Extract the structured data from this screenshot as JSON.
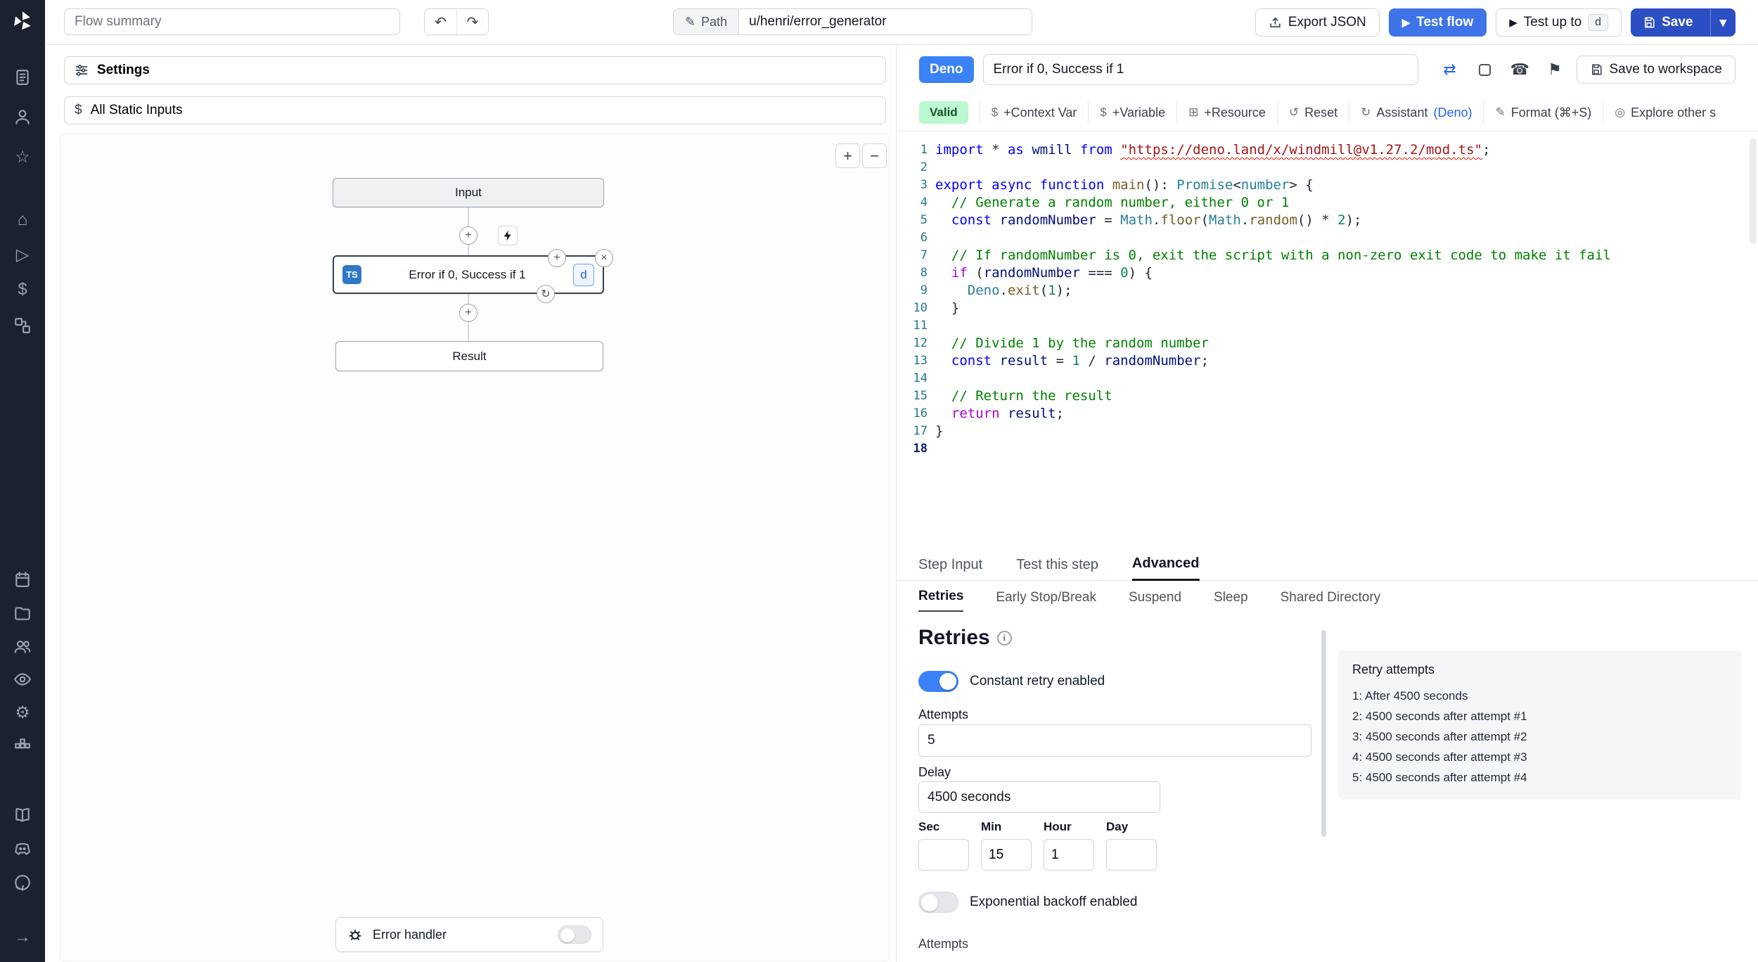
{
  "topbar": {
    "flow_summary_placeholder": "Flow summary",
    "path_label": "Path",
    "path_value": "u/henri/error_generator",
    "export_json_label": "Export JSON",
    "test_flow_label": "Test flow",
    "test_up_to_label": "Test up to",
    "test_up_to_badge": "d",
    "save_label": "Save"
  },
  "flow": {
    "settings_label": "Settings",
    "static_inputs_label": "All Static Inputs",
    "zoom_in_label": "+",
    "zoom_out_label": "−",
    "input_node_label": "Input",
    "step": {
      "lang_badge": "TS",
      "label": "Error if 0, Success if 1",
      "badge": "d"
    },
    "result_node_label": "Result",
    "error_handler_label": "Error handler"
  },
  "right_panel": {
    "header": {
      "lang_badge": "Deno",
      "step_name": "Error if 0, Success if 1",
      "save_to_workspace_label": "Save to workspace"
    },
    "toolbar": {
      "valid_label": "Valid",
      "context_var_label": "+Context Var",
      "variable_label": "+Variable",
      "resource_label": "+Resource",
      "reset_label": "Reset",
      "assistant_label": "Assistant",
      "assistant_lang_label": "(Deno)",
      "format_label": "Format (⌘+S)",
      "explore_label": "Explore other s"
    },
    "tabs": {
      "step_input": "Step Input",
      "test_step": "Test this step",
      "advanced": "Advanced"
    },
    "subtabs": {
      "retries": "Retries",
      "early": "Early Stop/Break",
      "suspend": "Suspend",
      "sleep": "Sleep",
      "shared": "Shared Directory"
    },
    "retries": {
      "title": "Retries",
      "constant_label": "Constant retry enabled",
      "attempts_label": "Attempts",
      "attempts_value": "5",
      "delay_label": "Delay",
      "delay_value": "4500 seconds",
      "time_fields": [
        {
          "label": "Sec",
          "value": ""
        },
        {
          "label": "Min",
          "value": "15"
        },
        {
          "label": "Hour",
          "value": "1"
        },
        {
          "label": "Day",
          "value": ""
        }
      ],
      "exponential_label": "Exponential backoff enabled",
      "next_section_label": "Attempts",
      "panel_title": "Retry attempts",
      "retry_attempts": [
        {
          "n": "1:",
          "text": "After 4500 seconds"
        },
        {
          "n": "2:",
          "text": "4500 seconds after attempt #1"
        },
        {
          "n": "3:",
          "text": "4500 seconds after attempt #2"
        },
        {
          "n": "4:",
          "text": "4500 seconds after attempt #3"
        },
        {
          "n": "5:",
          "text": "4500 seconds after attempt #4"
        }
      ]
    }
  },
  "editor": {
    "lines": [
      {
        "n": 1,
        "tokens": [
          [
            "import",
            "k"
          ],
          [
            " * ",
            "d"
          ],
          [
            "as",
            "k"
          ],
          [
            " ",
            "d"
          ],
          [
            "wmill",
            "v"
          ],
          [
            " ",
            "d"
          ],
          [
            "from",
            "k"
          ],
          [
            " ",
            "d"
          ],
          [
            "\"https://deno.land/x/windmill@v1.27.2/mod.ts\"",
            "ss"
          ],
          [
            ";",
            "d"
          ]
        ]
      },
      {
        "n": 2,
        "tokens": []
      },
      {
        "n": 3,
        "tokens": [
          [
            "export",
            "k"
          ],
          [
            " ",
            "d"
          ],
          [
            "async",
            "k"
          ],
          [
            " ",
            "d"
          ],
          [
            "function",
            "k"
          ],
          [
            " ",
            "d"
          ],
          [
            "main",
            "f"
          ],
          [
            "(): ",
            "d"
          ],
          [
            "Promise",
            "t"
          ],
          [
            "<",
            "d"
          ],
          [
            "number",
            "t"
          ],
          [
            "> {",
            "d"
          ]
        ]
      },
      {
        "n": 4,
        "tokens": [
          [
            "  // Generate a random number, either 0 or 1",
            "c"
          ]
        ]
      },
      {
        "n": 5,
        "tokens": [
          [
            "  ",
            "d"
          ],
          [
            "const",
            "k"
          ],
          [
            " ",
            "d"
          ],
          [
            "randomNumber",
            "v"
          ],
          [
            " = ",
            "d"
          ],
          [
            "Math",
            "t"
          ],
          [
            ".",
            "d"
          ],
          [
            "floor",
            "f"
          ],
          [
            "(",
            "d"
          ],
          [
            "Math",
            "t"
          ],
          [
            ".",
            "d"
          ],
          [
            "random",
            "f"
          ],
          [
            "() ",
            "d"
          ],
          [
            "* ",
            "d"
          ],
          [
            "2",
            "n"
          ],
          [
            ");",
            "d"
          ]
        ]
      },
      {
        "n": 6,
        "tokens": []
      },
      {
        "n": 7,
        "tokens": [
          [
            "  // If randomNumber is 0, exit the script with a non-zero exit code to make it fail",
            "c"
          ]
        ]
      },
      {
        "n": 8,
        "tokens": [
          [
            "  ",
            "d"
          ],
          [
            "if",
            "ck"
          ],
          [
            " (",
            "d"
          ],
          [
            "randomNumber",
            "v"
          ],
          [
            " === ",
            "d"
          ],
          [
            "0",
            "n"
          ],
          [
            ") {",
            "d"
          ]
        ]
      },
      {
        "n": 9,
        "tokens": [
          [
            "    ",
            "d"
          ],
          [
            "Deno",
            "t"
          ],
          [
            ".",
            "d"
          ],
          [
            "exit",
            "f"
          ],
          [
            "(",
            "d"
          ],
          [
            "1",
            "n"
          ],
          [
            ");",
            "d"
          ]
        ]
      },
      {
        "n": 10,
        "tokens": [
          [
            "  }",
            "d"
          ]
        ]
      },
      {
        "n": 11,
        "tokens": []
      },
      {
        "n": 12,
        "tokens": [
          [
            "  // Divide 1 by the random number",
            "c"
          ]
        ]
      },
      {
        "n": 13,
        "tokens": [
          [
            "  ",
            "d"
          ],
          [
            "const",
            "k"
          ],
          [
            " ",
            "d"
          ],
          [
            "result",
            "v"
          ],
          [
            " = ",
            "d"
          ],
          [
            "1",
            "n"
          ],
          [
            " / ",
            "d"
          ],
          [
            "randomNumber",
            "v"
          ],
          [
            ";",
            "d"
          ]
        ]
      },
      {
        "n": 14,
        "tokens": []
      },
      {
        "n": 15,
        "tokens": [
          [
            "  // Return the result",
            "c"
          ]
        ]
      },
      {
        "n": 16,
        "tokens": [
          [
            "  ",
            "d"
          ],
          [
            "return",
            "ck"
          ],
          [
            " ",
            "d"
          ],
          [
            "result",
            "v"
          ],
          [
            ";",
            "d"
          ]
        ]
      },
      {
        "n": 17,
        "tokens": [
          [
            "}",
            "d"
          ]
        ]
      },
      {
        "n": 18,
        "active": true,
        "tokens": []
      }
    ]
  }
}
